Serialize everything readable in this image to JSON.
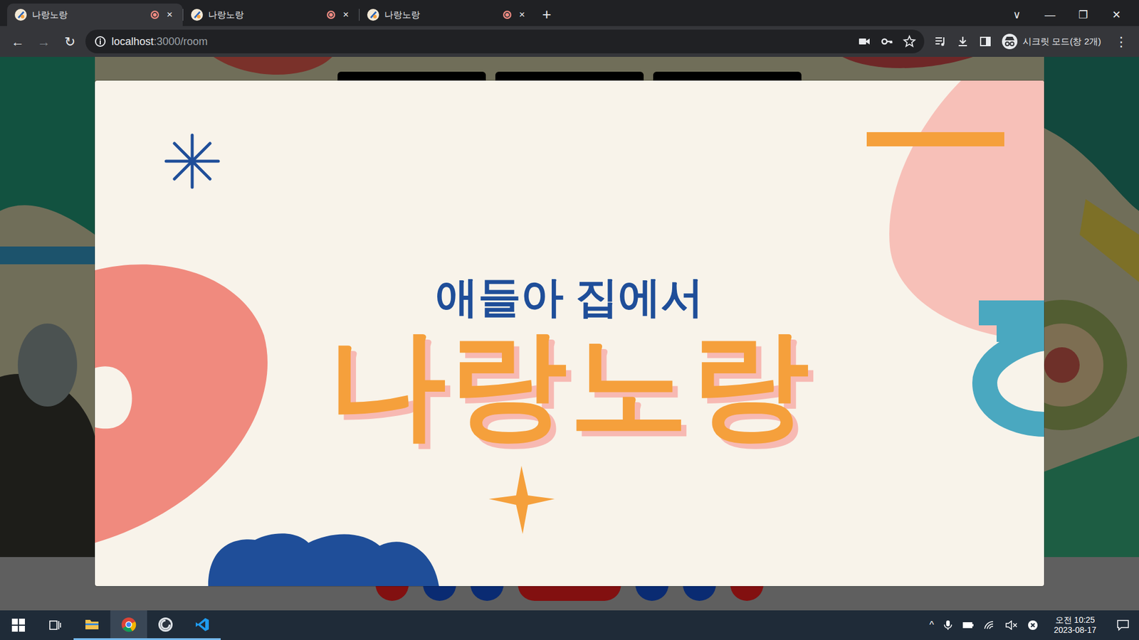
{
  "browser": {
    "tabs": [
      {
        "label": "나랑노랑",
        "selected": true,
        "recording": true,
        "close": "×"
      },
      {
        "label": "나랑노랑",
        "selected": false,
        "recording": true,
        "close": "×"
      },
      {
        "label": "나랑노랑",
        "selected": false,
        "recording": true,
        "close": "×"
      }
    ],
    "new_tab": "+",
    "window_controls": [
      "∨",
      "—",
      "❐",
      "✕"
    ]
  },
  "toolbar": {
    "back": {
      "glyph": "←",
      "disabled": false
    },
    "forward": {
      "glyph": "→",
      "disabled": true
    },
    "reload": {
      "glyph": "↻",
      "disabled": false
    },
    "address_host": "localhost",
    "address_path": ":3000/room",
    "profile_label": "시크릿 모드(창 2개)",
    "menu": "⋮"
  },
  "modal": {
    "subtitle": "애들아 집에서",
    "title": "나랑노랑"
  },
  "taskbar": {
    "apps": [
      {
        "name": "task-view",
        "running": false,
        "focused": false
      },
      {
        "name": "file-explorer",
        "running": true,
        "focused": false
      },
      {
        "name": "chrome",
        "running": true,
        "focused": true
      },
      {
        "name": "obs",
        "running": true,
        "focused": false
      },
      {
        "name": "vscode",
        "running": true,
        "focused": false
      }
    ],
    "tray_up": "^",
    "time": "오전 10:25",
    "date": "2023-08-17"
  }
}
